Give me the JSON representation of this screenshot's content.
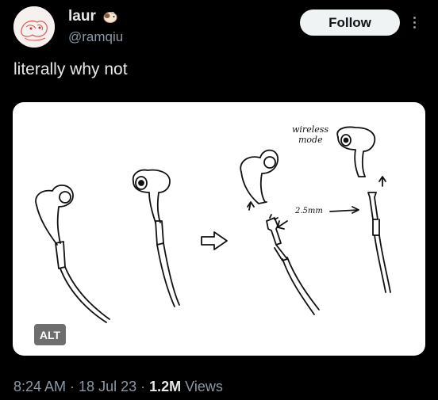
{
  "user": {
    "display_name": "laur",
    "handle": "@ramqiu",
    "avatar_icon": "avatar-sketch",
    "badge_icon": "guinea-pig-icon"
  },
  "actions": {
    "follow_label": "Follow",
    "more_icon": "more-vertical-icon"
  },
  "tweet": {
    "text": "literally why not"
  },
  "media": {
    "alt_label": "ALT",
    "annotations": {
      "wireless_line1": "wireless",
      "wireless_line2": "mode",
      "jack_size": "2.5mm"
    }
  },
  "meta": {
    "time": "8:24 AM",
    "separator": "·",
    "date": "18 Jul 23",
    "views_count": "1.2M",
    "views_label": "Views"
  },
  "colors": {
    "background": "#000000",
    "text": "#e7e9ea",
    "muted": "#8b98a5",
    "follow_bg": "#eff3f4"
  }
}
